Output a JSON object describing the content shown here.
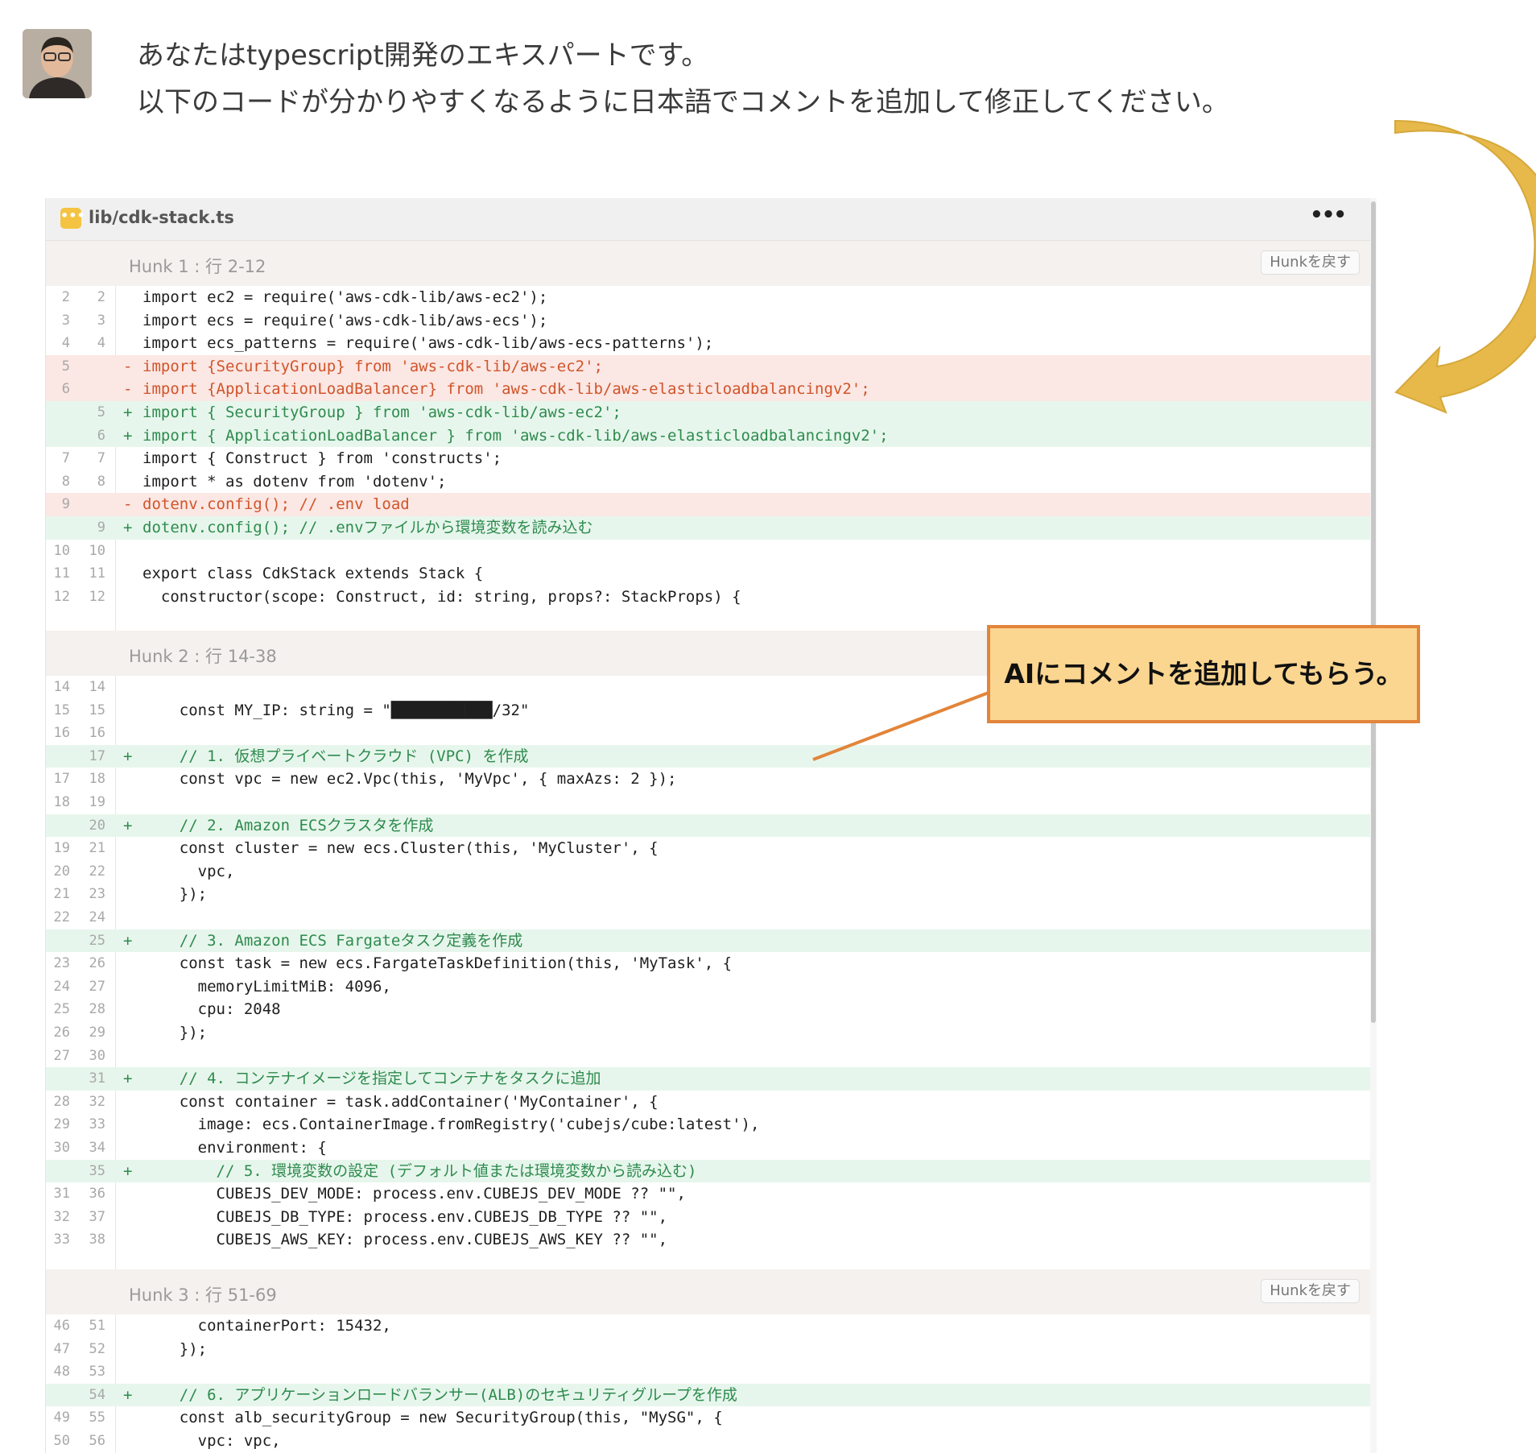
{
  "prompt": {
    "line1": "あなたはtypescript開発のエキスパートです。",
    "line2": "以下のコードが分かりやすくなるように日本語でコメントを追加して修正してください。"
  },
  "file": {
    "icon": "•••",
    "name": "lib/cdk-stack.ts",
    "menu": "•••"
  },
  "revert_label": "Hunkを戻す",
  "hunks": [
    {
      "title": "Hunk 1 : 行 2-12"
    },
    {
      "title": "Hunk 2 : 行 14-38"
    },
    {
      "title": "Hunk 3 : 行 51-69"
    }
  ],
  "lines": [
    {
      "old": "2",
      "new": "2",
      "type": "ctx",
      "code": "import ec2 = require('aws-cdk-lib/aws-ec2');"
    },
    {
      "old": "3",
      "new": "3",
      "type": "ctx",
      "code": "import ecs = require('aws-cdk-lib/aws-ecs');"
    },
    {
      "old": "4",
      "new": "4",
      "type": "ctx",
      "code": "import ecs_patterns = require('aws-cdk-lib/aws-ecs-patterns');"
    },
    {
      "old": "5",
      "new": "",
      "type": "del",
      "code": "import {SecurityGroup} from 'aws-cdk-lib/aws-ec2';"
    },
    {
      "old": "6",
      "new": "",
      "type": "del",
      "code": "import {ApplicationLoadBalancer} from 'aws-cdk-lib/aws-elasticloadbalancingv2';"
    },
    {
      "old": "",
      "new": "5",
      "type": "add",
      "code": "import { SecurityGroup } from 'aws-cdk-lib/aws-ec2';"
    },
    {
      "old": "",
      "new": "6",
      "type": "add",
      "code": "import { ApplicationLoadBalancer } from 'aws-cdk-lib/aws-elasticloadbalancingv2';"
    },
    {
      "old": "7",
      "new": "7",
      "type": "ctx",
      "code": "import { Construct } from 'constructs';"
    },
    {
      "old": "8",
      "new": "8",
      "type": "ctx",
      "code": "import * as dotenv from 'dotenv';"
    },
    {
      "old": "9",
      "new": "",
      "type": "del",
      "code": "dotenv.config(); // .env load"
    },
    {
      "old": "",
      "new": "9",
      "type": "add",
      "code": "dotenv.config(); // .envファイルから環境変数を読み込む"
    },
    {
      "old": "10",
      "new": "10",
      "type": "ctx",
      "code": ""
    },
    {
      "old": "11",
      "new": "11",
      "type": "ctx",
      "code": "export class CdkStack extends Stack {"
    },
    {
      "old": "12",
      "new": "12",
      "type": "ctx",
      "code": "  constructor(scope: Construct, id: string, props?: StackProps) {"
    },
    {
      "old": "14",
      "new": "14",
      "type": "ctx",
      "code": ""
    },
    {
      "old": "15",
      "new": "15",
      "type": "ctx",
      "code": "    const MY_IP: string = \"███████████/32\""
    },
    {
      "old": "16",
      "new": "16",
      "type": "ctx",
      "code": ""
    },
    {
      "old": "",
      "new": "17",
      "type": "add",
      "code": "    // 1. 仮想プライベートクラウド (VPC) を作成"
    },
    {
      "old": "17",
      "new": "18",
      "type": "ctx",
      "code": "    const vpc = new ec2.Vpc(this, 'MyVpc', { maxAzs: 2 });"
    },
    {
      "old": "18",
      "new": "19",
      "type": "ctx",
      "code": ""
    },
    {
      "old": "",
      "new": "20",
      "type": "add",
      "code": "    // 2. Amazon ECSクラスタを作成"
    },
    {
      "old": "19",
      "new": "21",
      "type": "ctx",
      "code": "    const cluster = new ecs.Cluster(this, 'MyCluster', {"
    },
    {
      "old": "20",
      "new": "22",
      "type": "ctx",
      "code": "      vpc,"
    },
    {
      "old": "21",
      "new": "23",
      "type": "ctx",
      "code": "    });"
    },
    {
      "old": "22",
      "new": "24",
      "type": "ctx",
      "code": ""
    },
    {
      "old": "",
      "new": "25",
      "type": "add",
      "code": "    // 3. Amazon ECS Fargateタスク定義を作成"
    },
    {
      "old": "23",
      "new": "26",
      "type": "ctx",
      "code": "    const task = new ecs.FargateTaskDefinition(this, 'MyTask', {"
    },
    {
      "old": "24",
      "new": "27",
      "type": "ctx",
      "code": "      memoryLimitMiB: 4096,"
    },
    {
      "old": "25",
      "new": "28",
      "type": "ctx",
      "code": "      cpu: 2048"
    },
    {
      "old": "26",
      "new": "29",
      "type": "ctx",
      "code": "    });"
    },
    {
      "old": "27",
      "new": "30",
      "type": "ctx",
      "code": ""
    },
    {
      "old": "",
      "new": "31",
      "type": "add",
      "code": "    // 4. コンテナイメージを指定してコンテナをタスクに追加"
    },
    {
      "old": "28",
      "new": "32",
      "type": "ctx",
      "code": "    const container = task.addContainer('MyContainer', {"
    },
    {
      "old": "29",
      "new": "33",
      "type": "ctx",
      "code": "      image: ecs.ContainerImage.fromRegistry('cubejs/cube:latest'),"
    },
    {
      "old": "30",
      "new": "34",
      "type": "ctx",
      "code": "      environment: {"
    },
    {
      "old": "",
      "new": "35",
      "type": "add",
      "code": "        // 5. 環境変数の設定 (デフォルト値または環境変数から読み込む)"
    },
    {
      "old": "31",
      "new": "36",
      "type": "ctx",
      "code": "        CUBEJS_DEV_MODE: process.env.CUBEJS_DEV_MODE ?? \"\","
    },
    {
      "old": "32",
      "new": "37",
      "type": "ctx",
      "code": "        CUBEJS_DB_TYPE: process.env.CUBEJS_DB_TYPE ?? \"\","
    },
    {
      "old": "33",
      "new": "38",
      "type": "ctx",
      "code": "        CUBEJS_AWS_KEY: process.env.CUBEJS_AWS_KEY ?? \"\","
    },
    {
      "old": "46",
      "new": "51",
      "type": "ctx",
      "code": "      containerPort: 15432,"
    },
    {
      "old": "47",
      "new": "52",
      "type": "ctx",
      "code": "    });"
    },
    {
      "old": "48",
      "new": "53",
      "type": "ctx",
      "code": ""
    },
    {
      "old": "",
      "new": "54",
      "type": "add",
      "code": "    // 6. アプリケーションロードバランサー(ALB)のセキュリティグループを作成"
    },
    {
      "old": "49",
      "new": "55",
      "type": "ctx",
      "code": "    const alb_securityGroup = new SecurityGroup(this, \"MySG\", {"
    },
    {
      "old": "50",
      "new": "56",
      "type": "ctx",
      "code": "      vpc: vpc,"
    }
  ],
  "callout": "AIにコメントを追加してもらう。",
  "colors": {
    "added_bg": "#e7f6ec",
    "removed_bg": "#fbe7e3",
    "callout_fill": "#fbd691",
    "callout_border": "#e2853a",
    "arrow": "#e6b94a"
  },
  "icons": [
    "avatar",
    "file-icon",
    "more-icon",
    "curved-arrow-icon"
  ]
}
